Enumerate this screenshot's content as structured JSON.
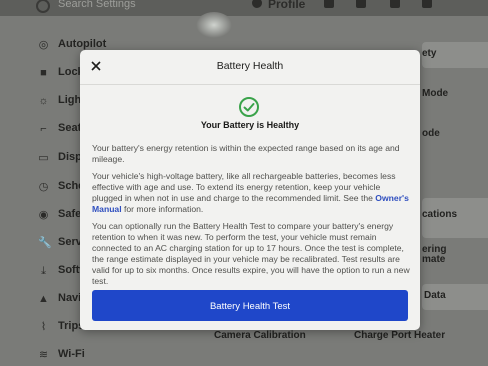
{
  "topbar": {
    "search_placeholder": "Search Settings",
    "profile_label": "Profile"
  },
  "sidebar": {
    "items": [
      {
        "label": "Autopilot",
        "icon": "steering-wheel-icon"
      },
      {
        "label": "Lock",
        "icon": "lock-icon"
      },
      {
        "label": "Ligh",
        "icon": "light-icon"
      },
      {
        "label": "Seat",
        "icon": "seat-icon"
      },
      {
        "label": "Disp",
        "icon": "display-icon"
      },
      {
        "label": "Sche",
        "icon": "schedule-icon"
      },
      {
        "label": "Safe",
        "icon": "safety-icon"
      },
      {
        "label": "Serv",
        "icon": "wrench-icon"
      },
      {
        "label": "Softw",
        "icon": "download-icon"
      },
      {
        "label": "Navi",
        "icon": "navigation-icon"
      },
      {
        "label": "Trips",
        "icon": "trips-icon"
      },
      {
        "label": "Wi-Fi",
        "icon": "wifi-icon"
      }
    ]
  },
  "right_panel": {
    "labels": [
      "ety",
      "Mode",
      "ode",
      "cations",
      "ering",
      "mate",
      "Data",
      "Charge Port Heater",
      "Camera Calibration"
    ]
  },
  "modal": {
    "title": "Battery Health",
    "status": "Your Battery is Healthy",
    "para1": "Your battery's energy retention is within the expected range based on its age and mileage.",
    "para2_before": "Your vehicle's high-voltage battery, like all rechargeable batteries, becomes less effective with age and use. To extend its energy retention, keep your vehicle plugged in when not in use and charge to the recommended limit. See the ",
    "para2_link": "Owner's Manual",
    "para2_after": " for more information.",
    "para3": "You can optionally run the Battery Health Test to compare your battery's energy retention to when it was new. To perform the test, your vehicle must remain connected to an AC charging station for up to 17 hours. Once the test is complete, the range estimate displayed in your vehicle may be recalibrated. Test results are valid for up to six months. Once results expire, you will have the option to run a new test.",
    "button_label": "Battery Health Test"
  },
  "colors": {
    "accent": "#1f47c9",
    "link": "#2f4fbf",
    "success": "#3aa34a"
  }
}
